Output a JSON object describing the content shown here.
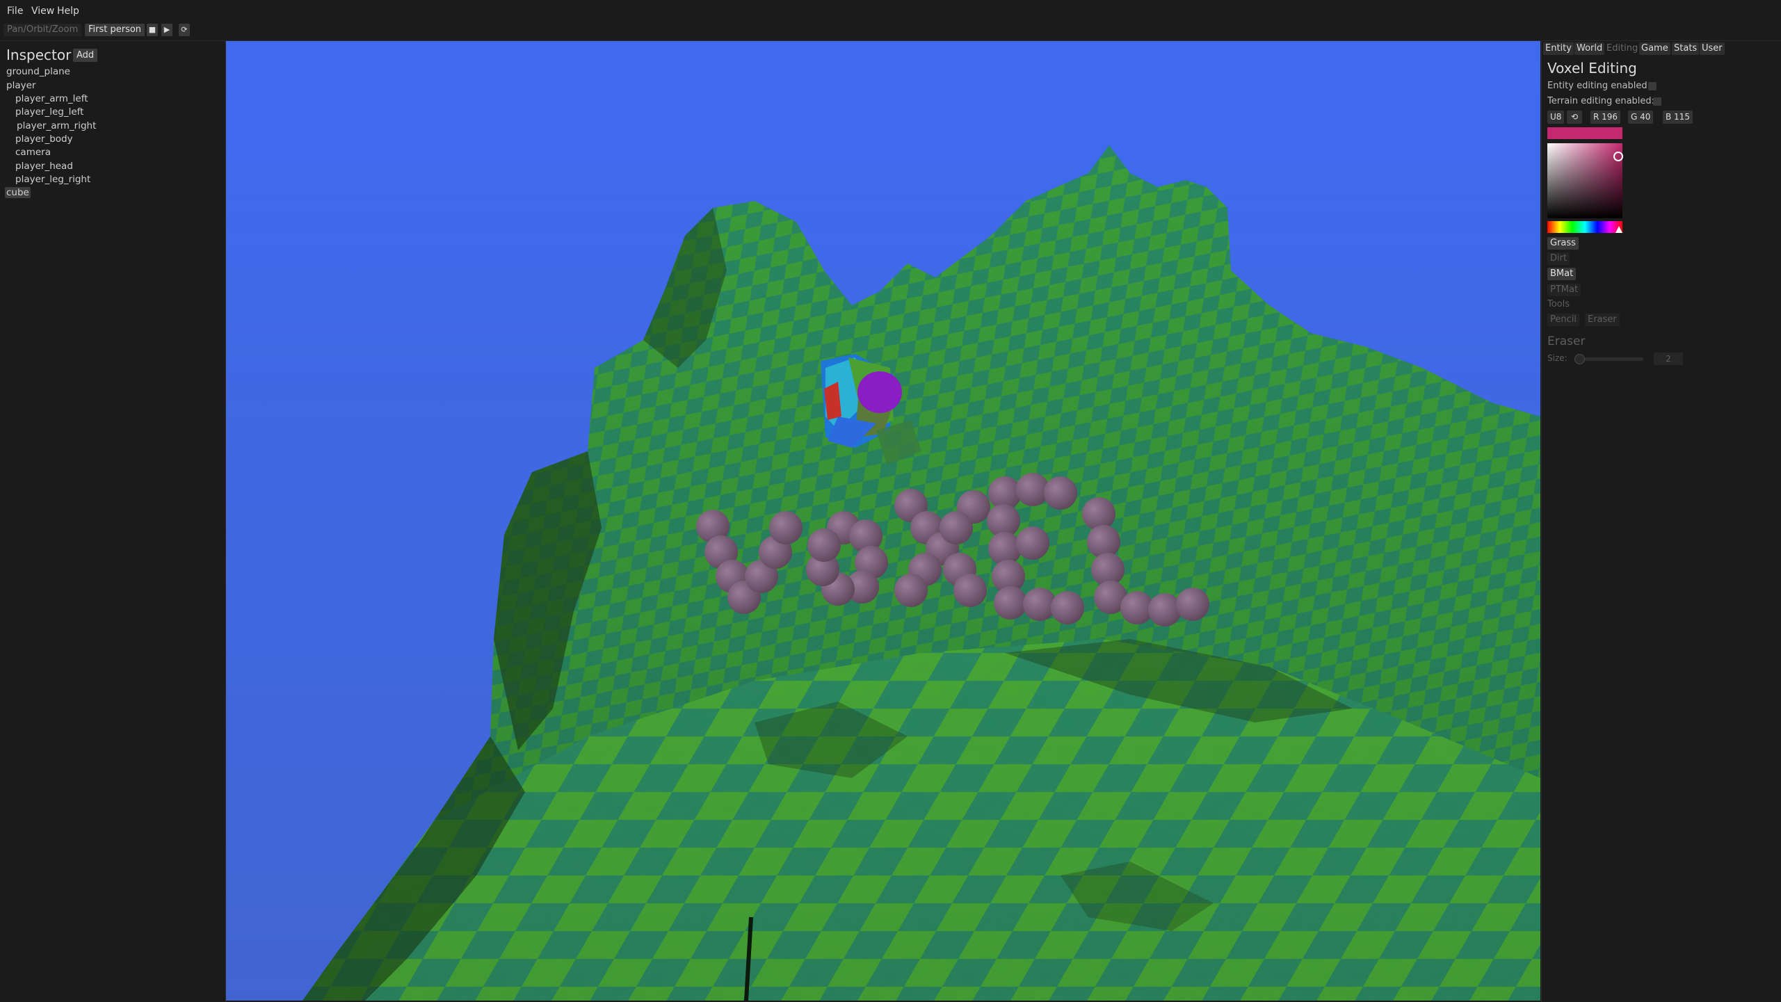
{
  "menu": {
    "file": "File",
    "view": "View",
    "help": "Help"
  },
  "toolbar": {
    "camera_mode_pan": "Pan/Orbit/Zoom",
    "camera_mode_first_person": "First person",
    "stop_icon": "stop-icon",
    "play_icon": "play-icon",
    "reload_icon": "reload-icon"
  },
  "inspector": {
    "title": "Inspector",
    "add_label": "Add",
    "items": [
      {
        "label": "ground_plane"
      },
      {
        "label": "player"
      },
      {
        "label": "player_arm_left"
      },
      {
        "label": "player_leg_left"
      },
      {
        "label": "player_arm_right"
      },
      {
        "label": "player_body"
      },
      {
        "label": "camera"
      },
      {
        "label": "player_head"
      },
      {
        "label": "player_leg_right"
      },
      {
        "label": "cube",
        "selected": true
      }
    ]
  },
  "viewport": {
    "scene_text": "VOXEL",
    "sky_color": "#4470f2",
    "terrain_colors": [
      "#3ea33a",
      "#2a8a63",
      "#5fc43a"
    ],
    "sphere_color": "#7a5c78"
  },
  "right_panel": {
    "tabs": [
      {
        "label": "Entity"
      },
      {
        "label": "World"
      },
      {
        "label": "Editing",
        "active": true
      },
      {
        "label": "Game"
      },
      {
        "label": "Stats"
      },
      {
        "label": "User"
      }
    ],
    "title": "Voxel Editing",
    "entity_editing_label": "Entity editing enabled:",
    "terrain_editing_label": "Terrain editing enabled:",
    "color_format": "U8",
    "color_r": "R 196",
    "color_g": "G 40",
    "color_b": "B 115",
    "current_color": "#c4286f",
    "materials": [
      {
        "label": "Grass",
        "enabled": true
      },
      {
        "label": "Dirt",
        "enabled": false
      },
      {
        "label": "BMat",
        "enabled": true
      },
      {
        "label": "PTMat",
        "enabled": false
      }
    ],
    "tools_label": "Tools",
    "tools": [
      {
        "label": "Pencil"
      },
      {
        "label": "Eraser"
      }
    ],
    "eraser_heading": "Eraser",
    "size_label": "Size:",
    "size_value": "2"
  }
}
